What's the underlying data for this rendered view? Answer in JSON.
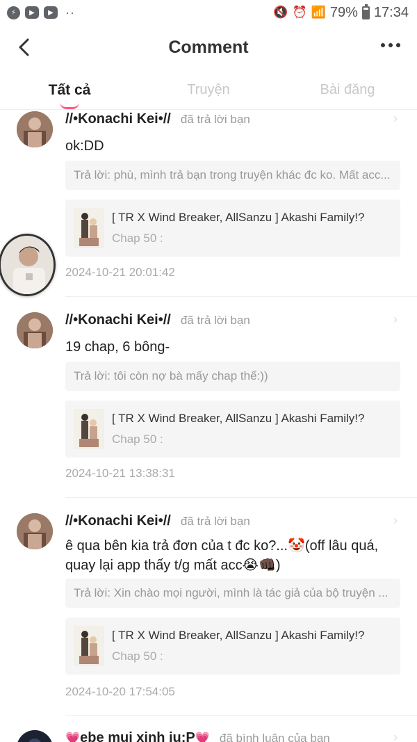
{
  "status_bar": {
    "battery": "79%",
    "time": "17:34"
  },
  "header": {
    "title": "Comment"
  },
  "tabs": [
    {
      "label": "Tất cả",
      "active": true
    },
    {
      "label": "Truyện",
      "active": false
    },
    {
      "label": "Bài đăng",
      "active": false
    }
  ],
  "comments": [
    {
      "username": "//•Konachi Kei•//",
      "action": "đã trả lời bạn",
      "text": "ok:DD",
      "reply": "Trả lời: phù, mình trả bạn trong truyện khác đc ko. Mất acc...",
      "story_title": "[ TR X Wind Breaker, AllSanzu ] Akashi Family!?",
      "story_chap": "Chap 50 :",
      "time": "2024-10-21 20:01:42"
    },
    {
      "username": "//•Konachi Kei•//",
      "action": "đã trả lời bạn",
      "text": "19 chap, 6 bông-",
      "reply": "Trả lời: tôi còn nợ bà mấy chap thế:))",
      "story_title": "[ TR X Wind Breaker, AllSanzu ] Akashi Family!?",
      "story_chap": "Chap 50 :",
      "time": "2024-10-21 13:38:31"
    },
    {
      "username": "//•Konachi Kei•//",
      "action": "đã trả lời bạn",
      "text_line1": "ê qua bên kia trả đơn của t đc ko?...🤡(off lâu quá,",
      "text_line2": "quay lại app thấy t/g mất acc😭👊🏿)",
      "reply": "Trả lời: Xin chào mọi người, mình là tác giả của bộ truyện ...",
      "story_title": "[ TR X Wind Breaker, AllSanzu ] Akashi Family!?",
      "story_chap": "Chap 50 :",
      "time": "2024-10-20 17:54:05"
    },
    {
      "username": "ebe mui xinh iu:P",
      "action": "đã bình luận của bạn"
    }
  ]
}
